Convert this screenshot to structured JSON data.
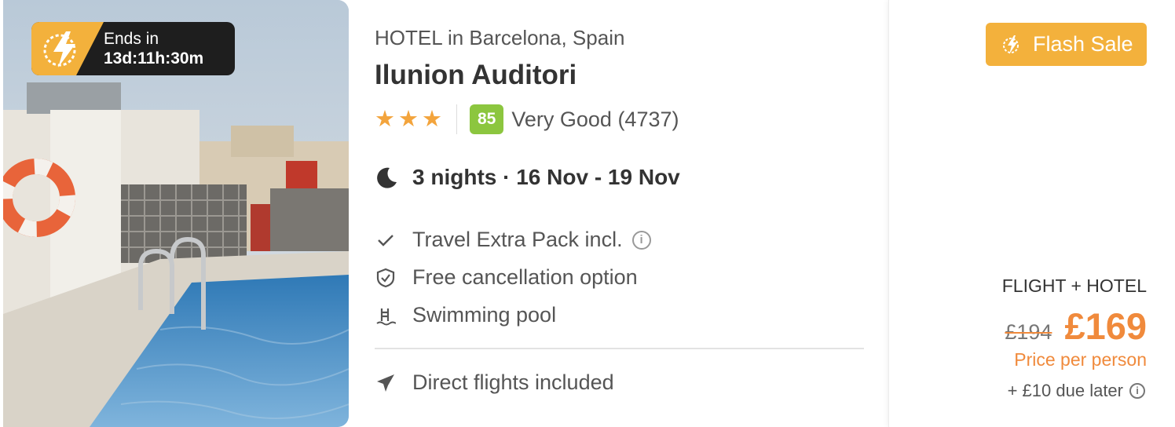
{
  "promo": {
    "timer_label": "Ends in",
    "timer_value": "13d:11h:30m",
    "badge_label": "Flash Sale",
    "accent_color": "#f3b13c"
  },
  "hotel": {
    "subtitle": "HOTEL in Barcelona, Spain",
    "name": "Ilunion Auditori",
    "stars": 3,
    "score": "85",
    "score_label": "Very Good (4737)",
    "score_color": "#8cc63f"
  },
  "stay": {
    "summary": "3 nights · 16 Nov - 19 Nov"
  },
  "features": [
    {
      "icon": "check-icon",
      "label": "Travel Extra Pack incl.",
      "has_info": true
    },
    {
      "icon": "shield-check-icon",
      "label": "Free cancellation option",
      "has_info": false
    },
    {
      "icon": "pool-icon",
      "label": "Swimming pool",
      "has_info": false
    }
  ],
  "flights": {
    "icon": "plane-icon",
    "label": "Direct flights included"
  },
  "price": {
    "package_type": "FLIGHT + HOTEL",
    "old_price": "£194",
    "new_price": "£169",
    "per_label": "Price per person",
    "due_later": "+ £10 due later",
    "price_color": "#f08a3c"
  }
}
